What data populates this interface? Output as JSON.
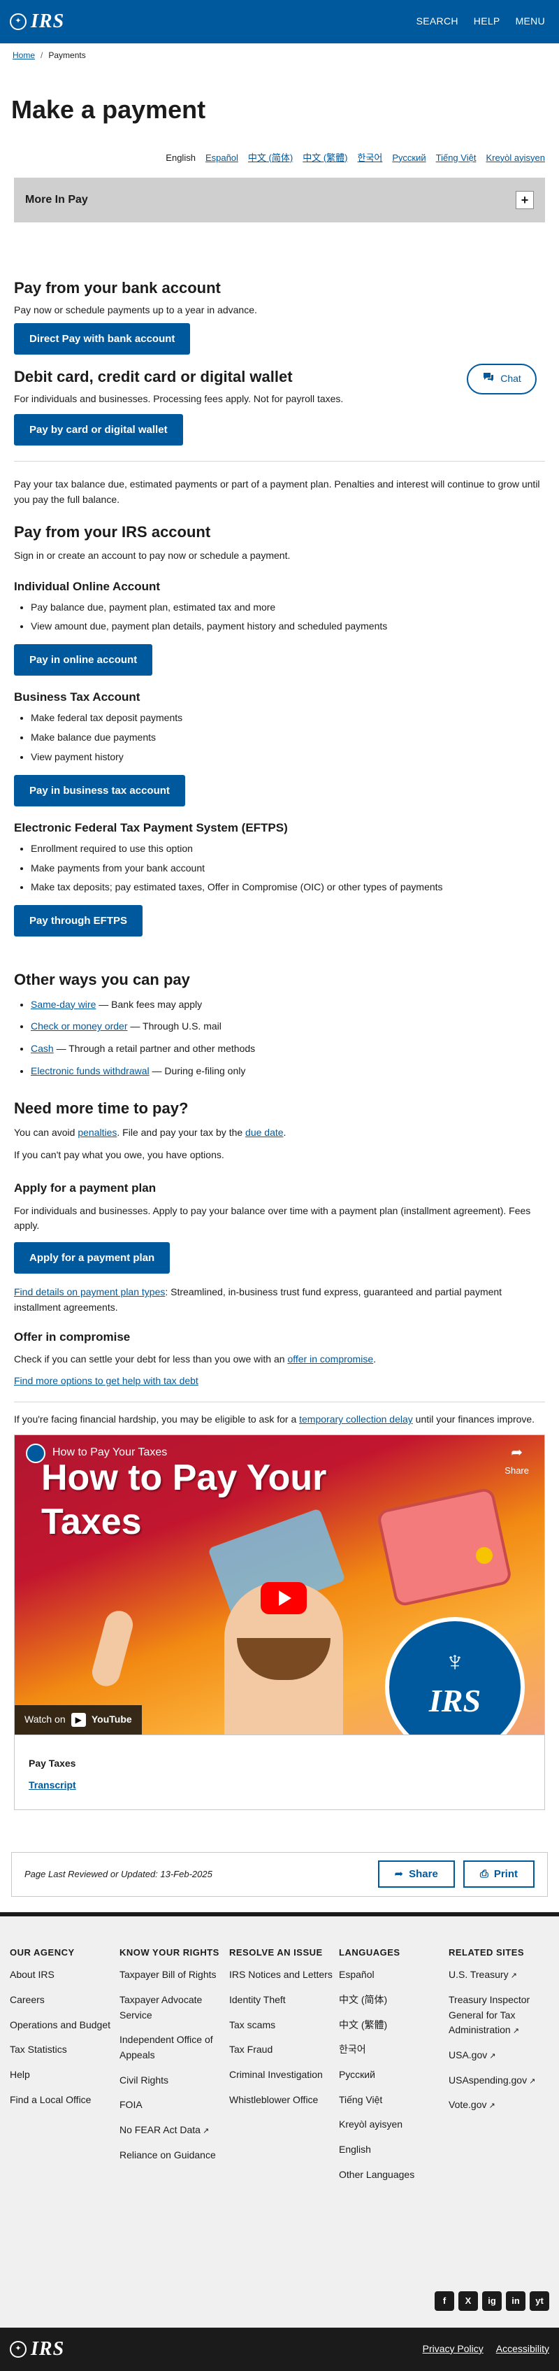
{
  "header": {
    "logo": "IRS",
    "nav": [
      "SEARCH",
      "HELP",
      "MENU"
    ]
  },
  "breadcrumb": {
    "home": "Home",
    "current": "Payments"
  },
  "page_title": "Make a payment",
  "languages": {
    "current": "English",
    "links": [
      "Español",
      "中文 (简体)",
      "中文 (繁體)",
      "한국어",
      "Русский",
      "Tiếng Việt",
      "Kreyòl ayisyen"
    ]
  },
  "accordion": {
    "title": "More In Pay"
  },
  "chat": {
    "label": "Chat"
  },
  "bank": {
    "heading": "Pay from your bank account",
    "text": "Pay now or schedule payments up to a year in advance.",
    "button": "Direct Pay with bank account"
  },
  "card": {
    "heading": "Debit card, credit card or digital wallet",
    "text": "For individuals and businesses. Processing fees apply. Not for payroll taxes.",
    "button": "Pay by card or digital wallet"
  },
  "balance_text": "Pay your tax balance due, estimated payments or part of a payment plan. Penalties and interest will continue to grow until you pay the full balance.",
  "irs_account": {
    "heading": "Pay from your IRS account",
    "text": "Sign in or create an account to pay now or schedule a payment.",
    "individual": {
      "heading": "Individual Online Account",
      "items": [
        "Pay balance due, payment plan, estimated tax and more",
        "View amount due, payment plan details, payment history and scheduled payments"
      ],
      "button": "Pay in online account"
    },
    "business": {
      "heading": "Business Tax Account",
      "items": [
        "Make federal tax deposit payments",
        "Make balance due payments",
        "View payment history"
      ],
      "button": "Pay in business tax account"
    },
    "eftps": {
      "heading": "Electronic Federal Tax Payment System (EFTPS)",
      "items": [
        "Enrollment required to use this option",
        "Make payments from your bank account",
        "Make tax deposits; pay estimated taxes, Offer in Compromise (OIC) or other types of payments"
      ],
      "button": "Pay through EFTPS"
    }
  },
  "other_ways": {
    "heading": "Other ways you can pay",
    "items": [
      {
        "link": "Same-day wire",
        "text": " — Bank fees may apply"
      },
      {
        "link": "Check or money order",
        "text": " — Through U.S. mail"
      },
      {
        "link": "Cash",
        "text": " — Through a retail partner and other methods"
      },
      {
        "link": "Electronic funds withdrawal",
        "text": " — During e-filing only"
      }
    ]
  },
  "more_time": {
    "heading": "Need more time to pay?",
    "p1_a": "You can avoid ",
    "p1_link1": "penalties",
    "p1_b": ". File and pay your tax by the ",
    "p1_link2": "due date",
    "p1_c": ".",
    "p2": "If you can't pay what you owe, you have options."
  },
  "payment_plan": {
    "heading": "Apply for a payment plan",
    "text": "For individuals and businesses. Apply to pay your balance over time with a payment plan (installment agreement). Fees apply.",
    "button": "Apply for a payment plan",
    "details_link": "Find details on payment plan types",
    "details_text": ": Streamlined, in-business trust fund express, guaranteed and partial payment installment agreements."
  },
  "oic": {
    "heading": "Offer in compromise",
    "text_a": "Check if you can settle your debt for less than you owe with an ",
    "link": "offer in compromise",
    "text_b": ".",
    "more_link": "Find more options to get help with tax debt"
  },
  "hardship": {
    "text_a": "If you're facing financial hardship, you may be eligible to ask for a ",
    "link": "temporary collection delay",
    "text_b": " until your finances improve."
  },
  "video": {
    "bar_title": "How to Pay Your Taxes",
    "share": "Share",
    "big_title_1": "How to Pay Your",
    "big_title_2": "Taxes",
    "seal_text": "IRS",
    "watch_on": "Watch on",
    "youtube": "YouTube",
    "caption_title": "Pay Taxes",
    "transcript": "Transcript"
  },
  "reviewed": {
    "text": "Page Last Reviewed or Updated: 13-Feb-2025",
    "share": "Share",
    "print": "Print"
  },
  "footer": {
    "columns": [
      {
        "heading": "OUR AGENCY",
        "links": [
          "About IRS",
          "Careers",
          "Operations and Budget",
          "Tax Statistics",
          "Help",
          "Find a Local Office"
        ]
      },
      {
        "heading": "KNOW YOUR RIGHTS",
        "links": [
          "Taxpayer Bill of Rights",
          "Taxpayer Advocate Service",
          "Independent Office of Appeals",
          "Civil Rights",
          "FOIA",
          "No FEAR Act Data",
          "Reliance on Guidance"
        ]
      },
      {
        "heading": "RESOLVE AN ISSUE",
        "links": [
          "IRS Notices and Letters",
          "Identity Theft",
          "Tax scams",
          "Tax Fraud",
          "Criminal Investigation",
          "Whistleblower Office"
        ]
      },
      {
        "heading": "LANGUAGES",
        "links": [
          "Español",
          "中文 (简体)",
          "中文 (繁體)",
          "한국어",
          "Русский",
          "Tiếng Việt",
          "Kreyòl ayisyen",
          "English",
          "Other Languages"
        ]
      },
      {
        "heading": "RELATED SITES",
        "links": [
          "U.S. Treasury",
          "Treasury Inspector General for Tax Administration",
          "USA.gov",
          "USAspending.gov",
          "Vote.gov"
        ]
      }
    ],
    "social": [
      "f",
      "X",
      "ig",
      "in",
      "yt"
    ],
    "bottom_links": [
      "Privacy Policy",
      "Accessibility"
    ]
  }
}
